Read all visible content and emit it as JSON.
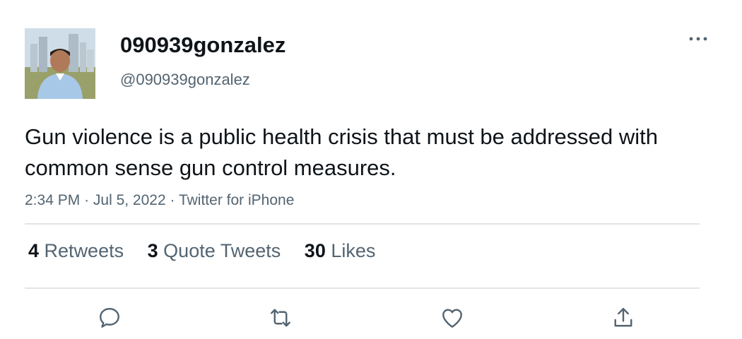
{
  "user": {
    "display_name": "090939gonzalez",
    "handle": "@090939gonzalez",
    "avatar_icon": "profile-photo"
  },
  "more_icon": "more-dots-icon",
  "tweet": {
    "text": "Gun violence is a public health crisis that must be addressed with common sense gun control measures.",
    "time": "2:34 PM",
    "date": "Jul 5, 2022",
    "source": "Twitter for iPhone",
    "separator": "·"
  },
  "stats": {
    "retweets_count": "4",
    "retweets_label": "Retweets",
    "quotes_count": "3",
    "quotes_label": "Quote Tweets",
    "likes_count": "30",
    "likes_label": "Likes"
  },
  "actions": [
    "reply-icon",
    "retweet-icon",
    "like-icon",
    "share-icon"
  ],
  "colors": {
    "text_primary": "#0f1419",
    "text_secondary": "#536471",
    "divider": "#e1e4e8",
    "icon": "#536471"
  }
}
